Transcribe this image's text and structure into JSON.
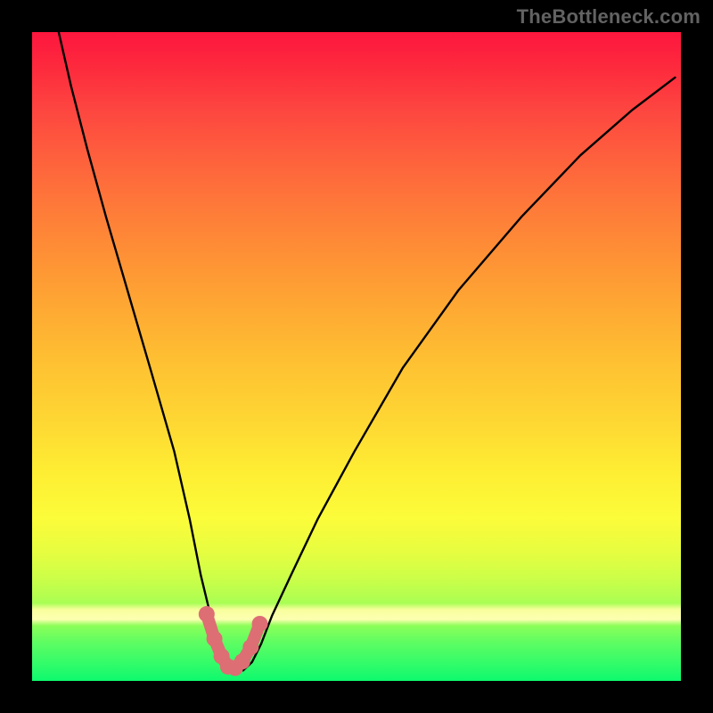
{
  "watermark": "TheBottleneck.com",
  "chart_data": {
    "type": "line",
    "title": "",
    "xlabel": "",
    "ylabel": "",
    "x": [
      0.041,
      0.06,
      0.085,
      0.114,
      0.147,
      0.182,
      0.219,
      0.243,
      0.26,
      0.275,
      0.288,
      0.3,
      0.312,
      0.325,
      0.339,
      0.353,
      0.37,
      0.399,
      0.44,
      0.497,
      0.571,
      0.657,
      0.754,
      0.845,
      0.925,
      0.991
    ],
    "values": [
      1.0,
      0.917,
      0.82,
      0.715,
      0.602,
      0.482,
      0.354,
      0.249,
      0.163,
      0.101,
      0.057,
      0.029,
      0.016,
      0.016,
      0.029,
      0.057,
      0.101,
      0.163,
      0.249,
      0.354,
      0.482,
      0.602,
      0.715,
      0.81,
      0.88,
      0.93
    ],
    "ylim": [
      0,
      1
    ],
    "xlim": [
      0,
      1
    ],
    "markers": {
      "color": "#dd6e74",
      "x": [
        0.269,
        0.281,
        0.292,
        0.302,
        0.313,
        0.324,
        0.337,
        0.351
      ],
      "y": [
        0.103,
        0.065,
        0.038,
        0.022,
        0.02,
        0.03,
        0.052,
        0.088
      ]
    }
  }
}
